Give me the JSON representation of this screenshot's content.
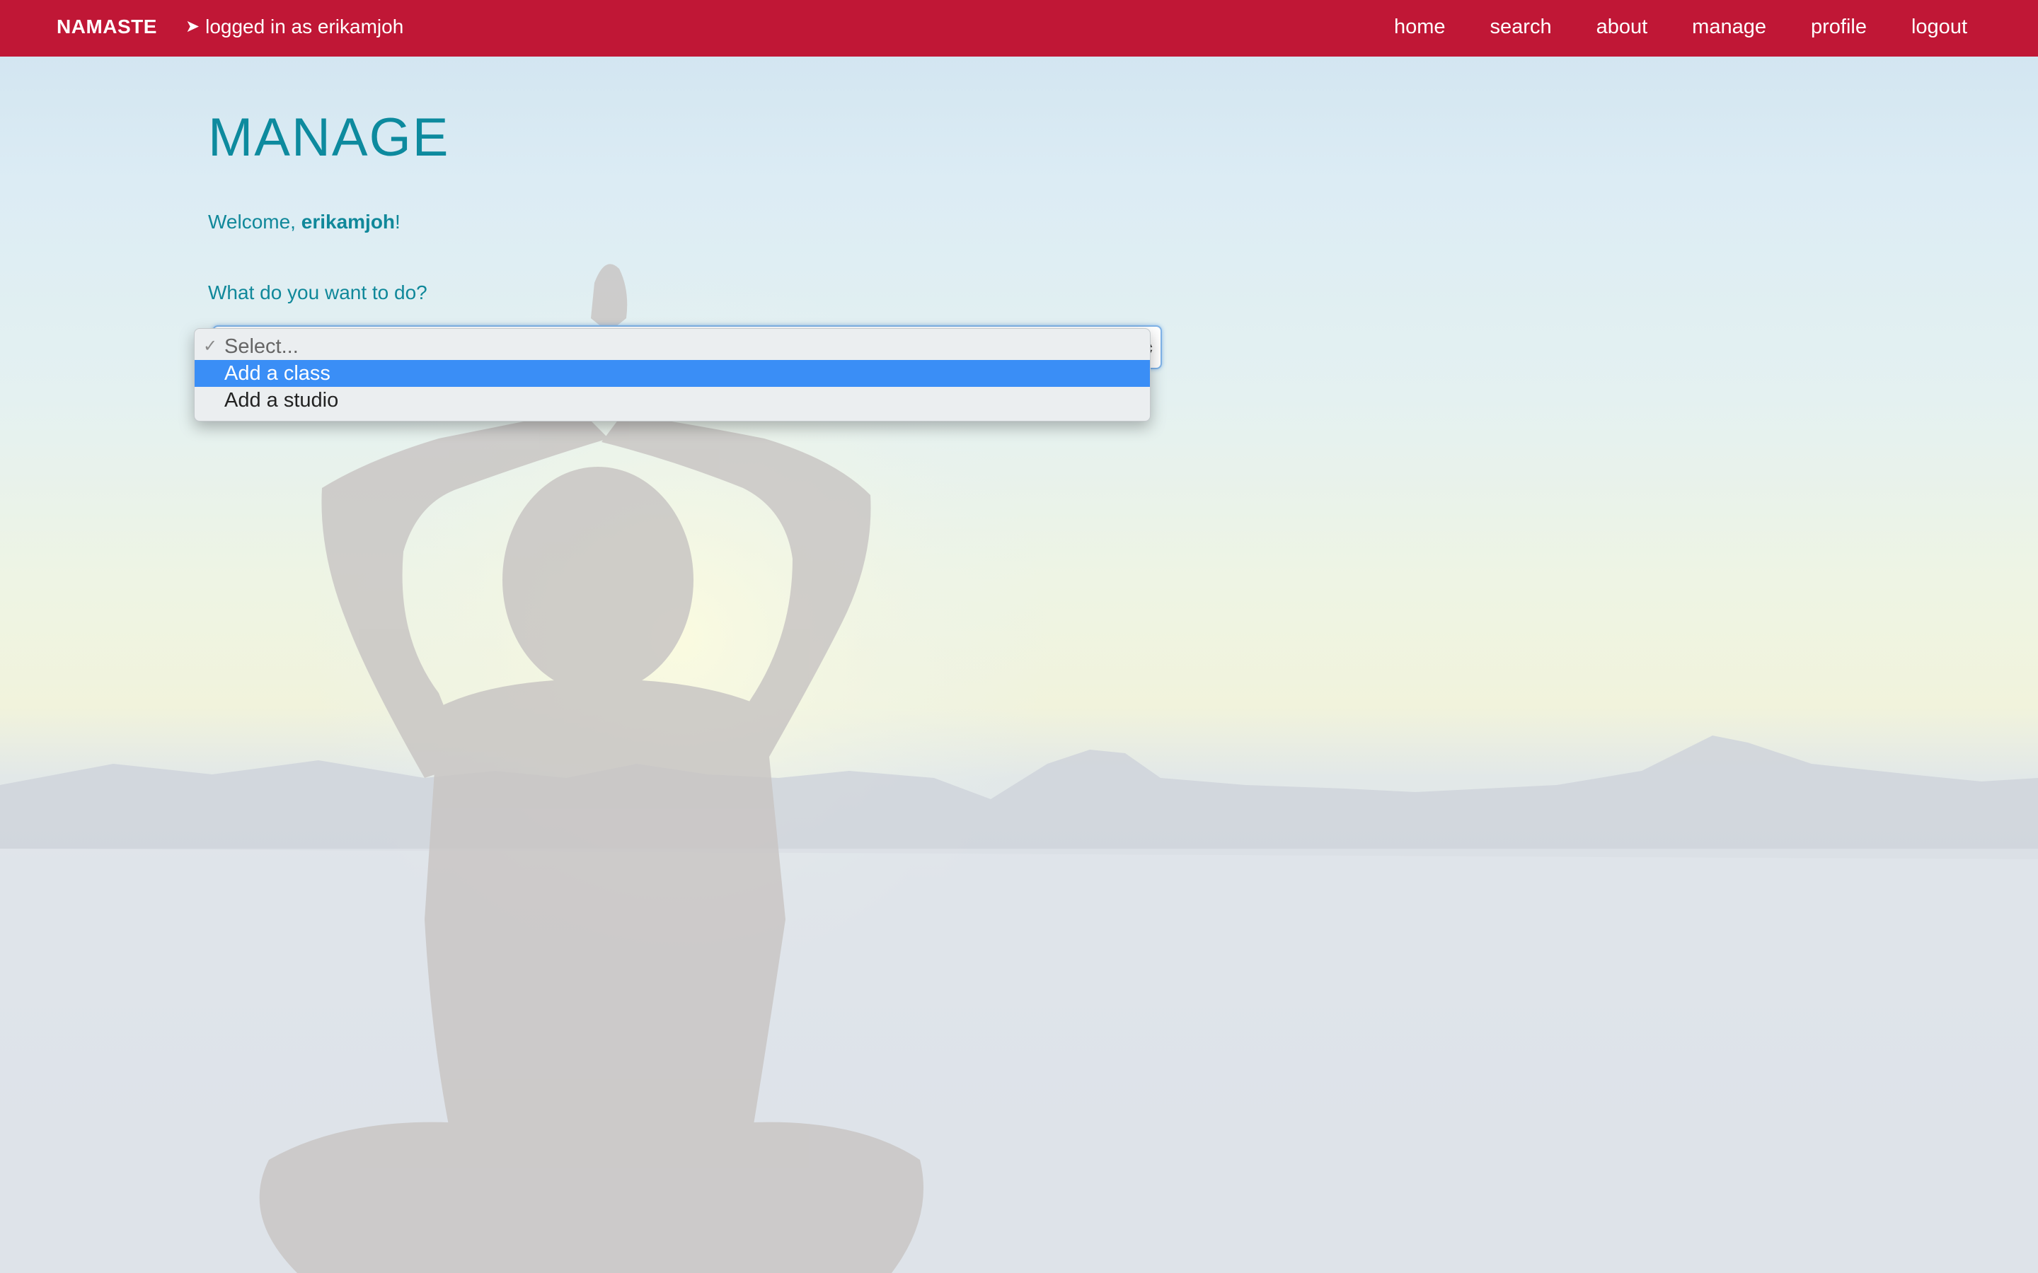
{
  "navbar": {
    "brand": "NAMASTE",
    "login_icon": "sign-in-icon",
    "login_status": "logged in as erikamjoh",
    "links": [
      "home",
      "search",
      "about",
      "manage",
      "profile",
      "logout"
    ],
    "background_color": "#c01736"
  },
  "main": {
    "title": "MANAGE",
    "welcome_prefix": "Welcome, ",
    "username": "erikamjoh",
    "welcome_suffix": "!",
    "question": "What do you want to do?",
    "text_color": "#10889a"
  },
  "select": {
    "options": [
      "Select...",
      "Add a class",
      "Add a studio"
    ],
    "selected": "Select...",
    "highlighted": "Add a class",
    "check_icon": "checkmark-icon",
    "highlight_color": "#3a8ef6"
  }
}
